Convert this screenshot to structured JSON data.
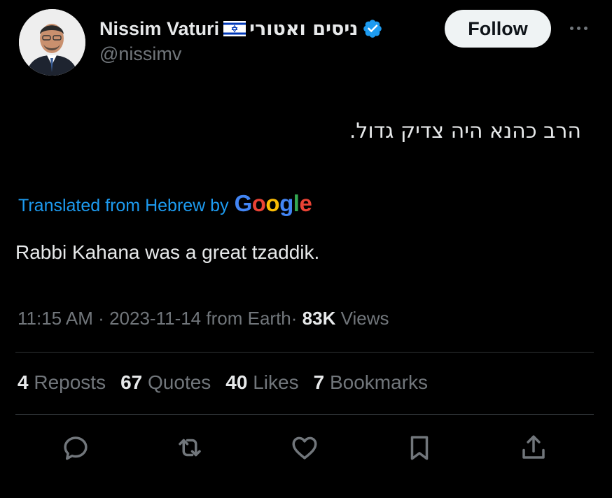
{
  "tweet": {
    "author": {
      "name": "Nissim Vaturi",
      "name_hebrew": "ניסים ואטורי",
      "handle": "@nissimv",
      "verified": true
    },
    "follow_label": "Follow",
    "text_original": "הרב כהנא היה צדיק גדול.",
    "translated_label": "Translated from Hebrew by",
    "translation_provider": "Google",
    "text_translated": "Rabbi Kahana was a great tzaddik.",
    "meta": {
      "time": "11:15 AM",
      "date": "2023-11-14",
      "source": "from Earth",
      "sep": "·",
      "views_count": "83K",
      "views_label": "Views"
    },
    "stats": [
      {
        "count": "4",
        "label": "Reposts"
      },
      {
        "count": "67",
        "label": "Quotes"
      },
      {
        "count": "40",
        "label": "Likes"
      },
      {
        "count": "7",
        "label": "Bookmarks"
      }
    ]
  },
  "actions": [
    "reply-icon",
    "repost-icon",
    "like-icon",
    "bookmark-icon",
    "share-icon"
  ],
  "colors": {
    "background": "#000000",
    "text": "#e7e9ea",
    "secondary": "#71767b",
    "link": "#1d9bf0",
    "verified": "#1d9bf0",
    "divider": "#2f3336"
  }
}
